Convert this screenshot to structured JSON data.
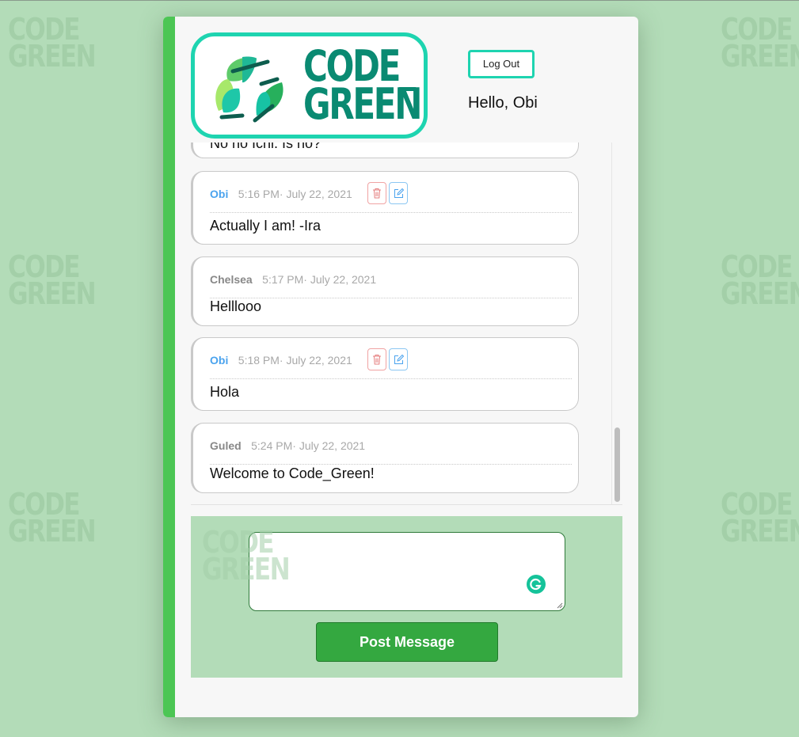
{
  "brand": {
    "logo_line1": "CODE_",
    "logo_line2": "GREEN",
    "watermark": "CODE_ GREEN"
  },
  "header": {
    "logout_label": "Log Out",
    "greeting": "Hello, Obi"
  },
  "messages": [
    {
      "author": "",
      "time": "",
      "text": "No no Icni. Is no?",
      "own": false
    },
    {
      "author": "Obi",
      "time": "5:16 PM· July 22, 2021",
      "text": "Actually I am! -Ira",
      "own": true
    },
    {
      "author": "Chelsea",
      "time": "5:17 PM· July 22, 2021",
      "text": "Helllooo",
      "own": false
    },
    {
      "author": "Obi",
      "time": "5:18 PM· July 22, 2021",
      "text": "Hola",
      "own": true
    },
    {
      "author": "Guled",
      "time": "5:24 PM· July 22, 2021",
      "text": "Welcome to Code_Green!",
      "own": false
    }
  ],
  "composer": {
    "value": "",
    "post_label": "Post Message"
  },
  "icons": {
    "delete": "trash-icon",
    "edit": "edit-icon",
    "grammarly": "grammarly-icon"
  },
  "colors": {
    "accent": "#1ed4b0",
    "bar": "#4cc654",
    "own_author": "#4aa3ee",
    "button": "#34a840",
    "background": "#b3dcb8"
  }
}
